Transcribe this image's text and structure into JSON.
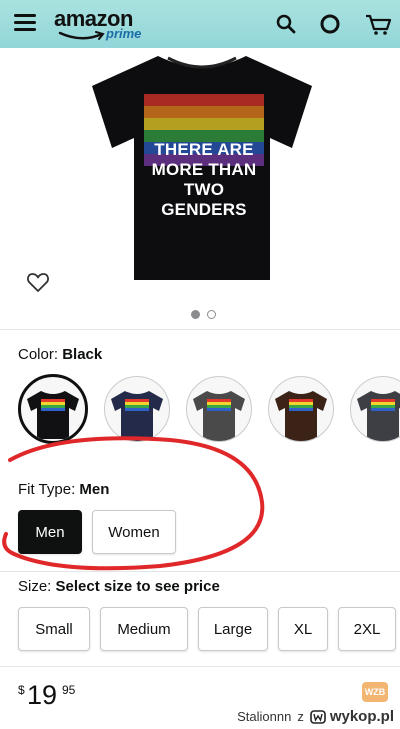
{
  "header": {
    "logo_word": "amazon",
    "logo_sub": "prime",
    "icons": [
      "menu-icon",
      "search-icon",
      "account-icon",
      "cart-icon"
    ],
    "background_color": "#9fdcdc"
  },
  "product": {
    "shirt_text_lines": [
      "THERE ARE",
      "MORE THAN",
      "TWO GENDERS"
    ],
    "shirt_color": "#0d0d10",
    "image_dots": 2,
    "active_dot": 0
  },
  "color": {
    "label": "Color:",
    "value": "Black",
    "swatches": [
      {
        "name": "Black",
        "hex": "#111114",
        "selected": true
      },
      {
        "name": "Navy",
        "hex": "#232a4a",
        "selected": false
      },
      {
        "name": "Dark Heather",
        "hex": "#4a4a4a",
        "selected": false
      },
      {
        "name": "Brown",
        "hex": "#3b2318",
        "selected": false
      },
      {
        "name": "Asphalt",
        "hex": "#3d3f45",
        "selected": false
      }
    ]
  },
  "fit": {
    "label": "Fit Type:",
    "value": "Men",
    "options": [
      "Men",
      "Women"
    ],
    "selected": "Men"
  },
  "size": {
    "label": "Size:",
    "value": "Select size to see price",
    "options": [
      "Small",
      "Medium",
      "Large",
      "XL",
      "2XL"
    ]
  },
  "price": {
    "currency": "$",
    "whole": "19",
    "fraction": "95"
  },
  "credit": {
    "user": "Stalionnn",
    "joiner": "z",
    "site": "wykop.pl"
  },
  "watermark": "WZB",
  "accent_colors": {
    "selected_button": "#0f1111",
    "annotation_red": "#e0282a"
  }
}
